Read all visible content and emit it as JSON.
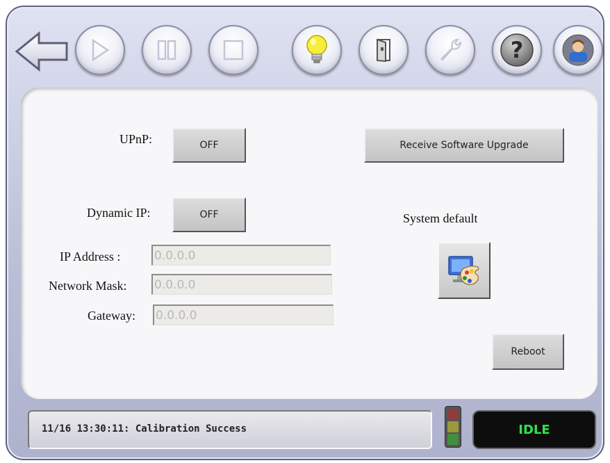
{
  "toolbar": {
    "buttons": [
      {
        "icon": "back-arrow-icon",
        "state": "enabled"
      },
      {
        "icon": "play-icon",
        "state": "disabled"
      },
      {
        "icon": "pause-icon",
        "state": "disabled"
      },
      {
        "icon": "stop-icon",
        "state": "disabled"
      },
      {
        "icon": "lightbulb-icon",
        "state": "enabled"
      },
      {
        "icon": "door-icon",
        "state": "enabled"
      },
      {
        "icon": "wrench-icon",
        "state": "disabled"
      },
      {
        "icon": "help-icon",
        "state": "enabled"
      },
      {
        "icon": "user-icon",
        "state": "enabled"
      }
    ],
    "help_glyph": "?"
  },
  "settings": {
    "upnp_label": "UPnP:",
    "upnp_value": "OFF",
    "dynamic_ip_label": "Dynamic IP:",
    "dynamic_ip_value": "OFF",
    "ip_address_label": "IP Address :",
    "ip_address_value": "0.0.0.0",
    "network_mask_label": "Network Mask:",
    "network_mask_value": "0.0.0.0",
    "gateway_label": "Gateway:",
    "gateway_value": "0.0.0.0"
  },
  "actions": {
    "upgrade_label": "Receive Software Upgrade",
    "system_default_label": "System default",
    "system_default_icon": "palette-monitor-icon",
    "reboot_label": "Reboot"
  },
  "status": {
    "message": "11/16 13:30:11: Calibration Success",
    "state": "IDLE",
    "state_color": "#2fe34b",
    "lamp_colors": [
      "#8e3c3c",
      "#9a9a3c",
      "#3f8f3f"
    ]
  }
}
